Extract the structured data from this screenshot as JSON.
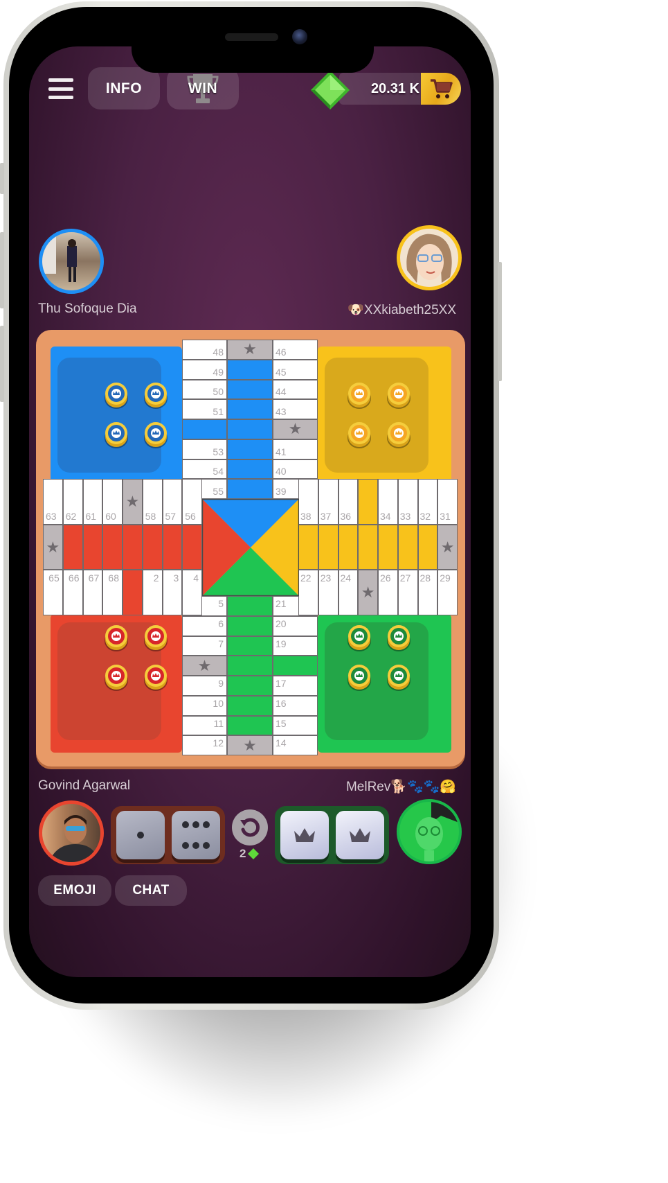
{
  "header": {
    "menu_icon": "hamburger-menu-icon",
    "info_label": "INFO",
    "win_label": "WIN",
    "win_icon": "trophy-icon",
    "currency_icon": "green-gem-icon",
    "balance": "20.31 K",
    "shop_icon": "shopping-cart-icon"
  },
  "players": {
    "top_left": {
      "name": "Thu Sofoque Dia",
      "color": "#1e8ff5",
      "avatar": "photo-avatar"
    },
    "top_right": {
      "name": "XXkiabeth25XX",
      "name_prefix_emoji": "🐶",
      "color": "#f8c21b",
      "avatar": "cartoon-woman-avatar"
    },
    "bottom_left": {
      "name": "Govind Agarwal",
      "color": "#e8452f",
      "avatar": "photo-avatar"
    },
    "bottom_right": {
      "name": "MelRev",
      "name_suffix_emoji": "🐕🐾🐾🤗",
      "color": "#1fc552",
      "avatar": "cartoon-avatar"
    }
  },
  "board": {
    "colors": {
      "blue": "#1e8ff5",
      "yellow": "#f8c21b",
      "red": "#e8452f",
      "green": "#1fc552",
      "safe": "#bdb7b9",
      "frame": "#e89a67"
    },
    "top_arm": {
      "left_col": [
        "48",
        "49",
        "50",
        "51",
        "",
        "53",
        "54",
        "55"
      ],
      "right_col": [
        "46",
        "45",
        "44",
        "43",
        "",
        "41",
        "40",
        "39"
      ],
      "safe_cells": [
        "mid-0",
        "right-4"
      ]
    },
    "bottom_arm": {
      "left_col": [
        "5",
        "6",
        "7",
        "",
        "9",
        "10",
        "11",
        "12"
      ],
      "right_col": [
        "21",
        "20",
        "19",
        "",
        "17",
        "16",
        "15",
        "14"
      ],
      "safe_cells": [
        "left-3",
        "mid-7"
      ]
    },
    "left_arm": {
      "top_row": [
        "63",
        "62",
        "61",
        "60",
        "",
        "58",
        "57",
        "56"
      ],
      "bottom_row": [
        "65",
        "66",
        "67",
        "68",
        "",
        "2",
        "3",
        "4"
      ],
      "safe_cells": [
        "top-4",
        "mid-0"
      ]
    },
    "right_arm": {
      "top_row": [
        "38",
        "37",
        "36",
        "",
        "34",
        "33",
        "32",
        "31"
      ],
      "bottom_row": [
        "22",
        "23",
        "24",
        "",
        "26",
        "27",
        "28",
        "29"
      ],
      "safe_cells": [
        "mid-7",
        "bottom-3"
      ]
    },
    "tokens": {
      "blue": 4,
      "yellow": 4,
      "red": 4,
      "green": 4
    }
  },
  "controls": {
    "my_dice": [
      1,
      6
    ],
    "opponent_dice": [
      "crown",
      "crown"
    ],
    "undo_icon": "undo-icon",
    "undo_cost": "2",
    "undo_cost_icon": "green-gem-icon",
    "emoji_label": "EMOJI",
    "chat_label": "CHAT"
  }
}
